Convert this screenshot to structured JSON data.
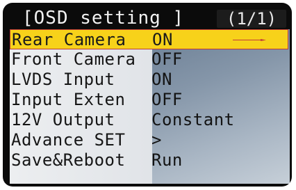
{
  "header": {
    "title": "[OSD setting ]",
    "page_indicator": "(1/1)"
  },
  "menu": [
    {
      "label": "Rear Camera",
      "value": "ON",
      "selected": true
    },
    {
      "label": "Front Camera",
      "value": "OFF",
      "selected": false
    },
    {
      "label": "LVDS Input",
      "value": "ON",
      "selected": false
    },
    {
      "label": "Input Exten",
      "value": "OFF",
      "selected": false
    },
    {
      "label": "12V Output",
      "value": "Constant",
      "selected": false
    },
    {
      "label": "Advance SET",
      "value": ">",
      "selected": false
    },
    {
      "label": "Save&Reboot",
      "value": "Run",
      "selected": false
    }
  ],
  "colors": {
    "highlight": "#f7d21a",
    "highlight_border": "#b83838",
    "arrow": "#c43a3a",
    "screen_bezel": "#0b0b0b"
  },
  "icons": {
    "selected_row": "right-arrow-icon"
  }
}
